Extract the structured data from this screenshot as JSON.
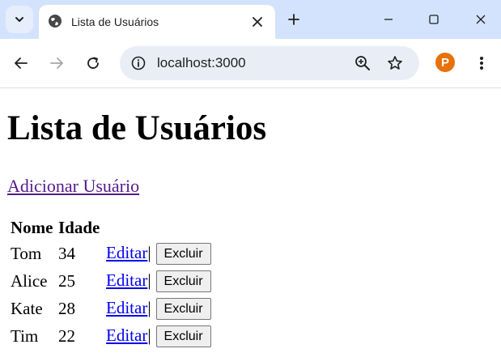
{
  "browser": {
    "tab_title": "Lista de Usuários",
    "url": "localhost:3000",
    "profile_initial": "P"
  },
  "page": {
    "heading": "Lista de Usuários",
    "add_link": "Adicionar Usuário",
    "table": {
      "headers": [
        "Nome",
        "Idade"
      ],
      "rows": [
        {
          "name": "Tom",
          "age": "34"
        },
        {
          "name": "Alice",
          "age": "25"
        },
        {
          "name": "Kate",
          "age": "28"
        },
        {
          "name": "Tim",
          "age": "22"
        }
      ],
      "edit_label": "Editar",
      "separator": "|",
      "delete_label": "Excluir"
    }
  },
  "colors": {
    "tabstrip": "#d3e3fd",
    "omnibox": "#e9eef6",
    "link_unvisited": "#0000ee",
    "link_visited": "#551a8b",
    "avatar": "#e8710a"
  }
}
